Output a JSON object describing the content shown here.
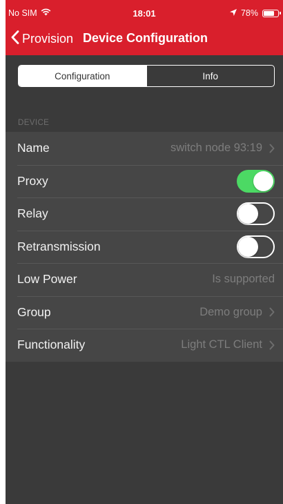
{
  "colors": {
    "accent": "#d91f2c",
    "background": "#3a3a3a",
    "cell": "#464646",
    "switch_on": "#4cd964"
  },
  "status_bar": {
    "carrier": "No SIM",
    "time": "18:01",
    "battery_pct": "78%",
    "battery_level": 0.78
  },
  "nav": {
    "back_label": "Provision",
    "title": "Device Configuration"
  },
  "segments": [
    {
      "label": "Configuration",
      "selected": true
    },
    {
      "label": "Info",
      "selected": false
    }
  ],
  "section": {
    "header": "DEVICE"
  },
  "rows": [
    {
      "label": "Name",
      "value": "switch node 93:19",
      "disclosure": true
    },
    {
      "label": "Proxy",
      "toggle": true
    },
    {
      "label": "Relay",
      "toggle": false
    },
    {
      "label": "Retransmission",
      "toggle": false
    },
    {
      "label": "Low Power",
      "value": "Is supported",
      "disclosure": false
    },
    {
      "label": "Group",
      "value": "Demo group",
      "disclosure": true
    },
    {
      "label": "Functionality",
      "value": "Light CTL Client",
      "disclosure": true
    }
  ]
}
